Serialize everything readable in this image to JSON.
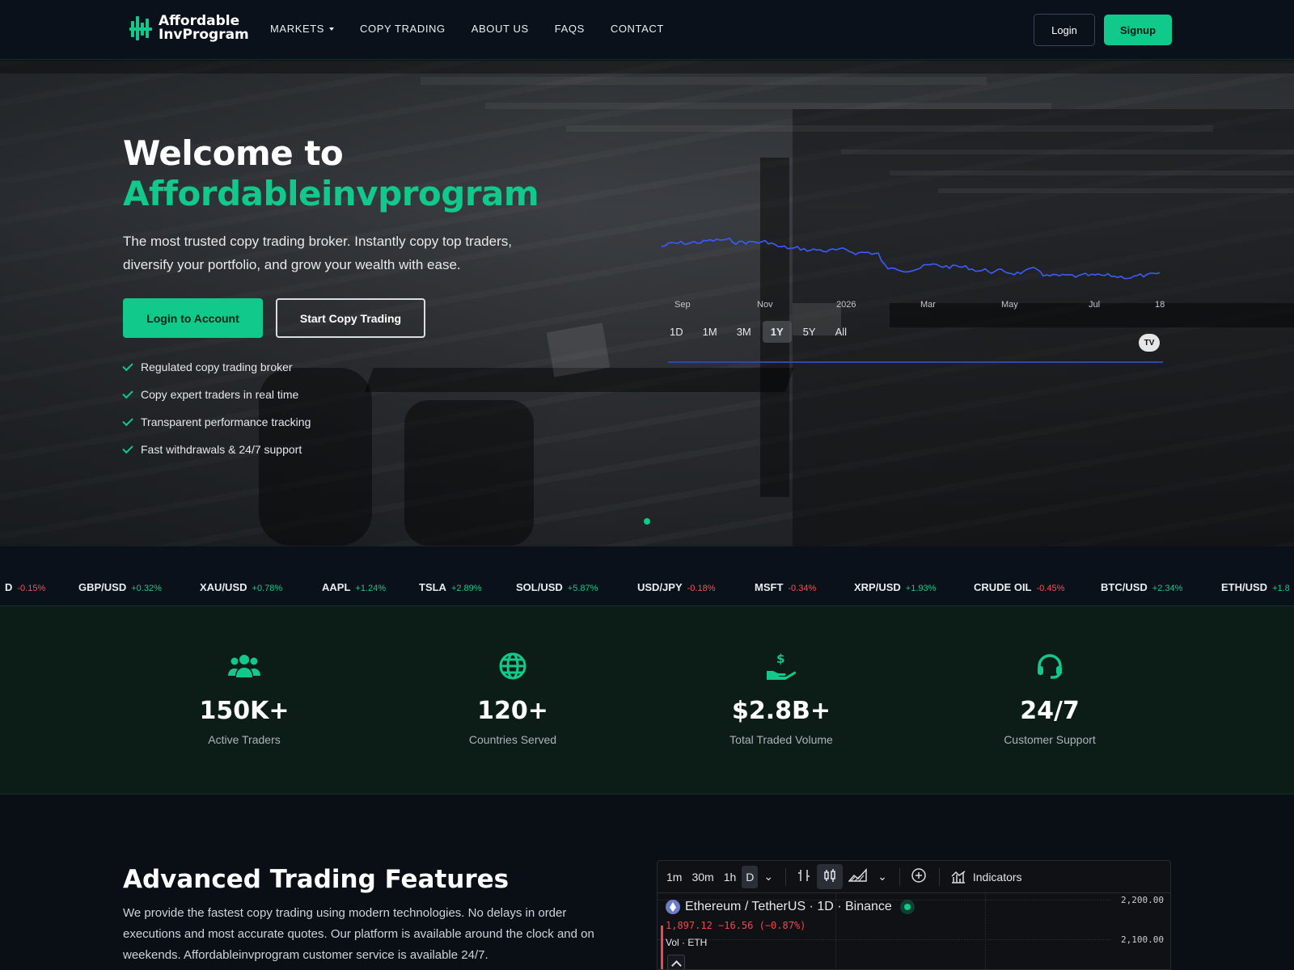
{
  "nav": {
    "logo_line1": "Affordable",
    "logo_line2": "InvProgram",
    "items": [
      "MARKETS",
      "COPY TRADING",
      "ABOUT US",
      "FAQS",
      "CONTACT"
    ],
    "login": "Login",
    "signup": "Signup"
  },
  "hero": {
    "title_line1": "Welcome to",
    "title_line2": "Affordableinvprogram",
    "lead": "The most trusted copy trading broker. Instantly copy top traders, diversify your portfolio, and grow your wealth with ease.",
    "btn_login": "Login to Account",
    "btn_copy": "Start Copy Trading",
    "features": [
      "Regulated copy trading broker",
      "Copy expert traders in real time",
      "Transparent performance tracking",
      "Fast withdrawals & 24/7 support"
    ],
    "mini_chart": {
      "months": [
        "Sep",
        "Nov",
        "2026",
        "Mar",
        "May",
        "Jul",
        "18"
      ],
      "ranges": [
        "1D",
        "1M",
        "3M",
        "1Y",
        "5Y",
        "All"
      ],
      "active_range": "1Y",
      "badge": "TV",
      "line_color": "#3b5cff"
    }
  },
  "ticker": [
    {
      "sym": "D",
      "chg": "-0.15%",
      "dir": "down"
    },
    {
      "sym": "GBP/USD",
      "chg": "+0.32%",
      "dir": "up"
    },
    {
      "sym": "XAU/USD",
      "chg": "+0.78%",
      "dir": "up"
    },
    {
      "sym": "AAPL",
      "chg": "+1.24%",
      "dir": "up"
    },
    {
      "sym": "TSLA",
      "chg": "+2.89%",
      "dir": "up"
    },
    {
      "sym": "SOL/USD",
      "chg": "+5.87%",
      "dir": "up"
    },
    {
      "sym": "USD/JPY",
      "chg": "-0.18%",
      "dir": "down"
    },
    {
      "sym": "MSFT",
      "chg": "-0.34%",
      "dir": "down"
    },
    {
      "sym": "XRP/USD",
      "chg": "+1.93%",
      "dir": "up"
    },
    {
      "sym": "CRUDE OIL",
      "chg": "-0.45%",
      "dir": "down"
    },
    {
      "sym": "BTC/USD",
      "chg": "+2.34%",
      "dir": "up"
    },
    {
      "sym": "ETH/USD",
      "chg": "+1.8",
      "dir": "up"
    }
  ],
  "stats": [
    {
      "icon": "users-icon",
      "num": "150K+",
      "label": "Active Traders"
    },
    {
      "icon": "globe-icon",
      "num": "120+",
      "label": "Countries Served"
    },
    {
      "icon": "money-hand-icon",
      "num": "$2.8B+",
      "label": "Total Traded Volume"
    },
    {
      "icon": "headset-icon",
      "num": "24/7",
      "label": "Customer Support"
    }
  ],
  "advanced": {
    "title": "Advanced Trading Features",
    "text": "We provide the fastest copy trading using modern technologies. No delays in order executions and most accurate quotes. Our platform is available around the clock and on weekends. Affordableinvprogram customer service is available 24/7."
  },
  "tv_widget": {
    "intervals": [
      "1m",
      "30m",
      "1h",
      "D"
    ],
    "indicators": "Indicators",
    "symbol": "Ethereum / TetherUS · 1D · Binance",
    "price": "1,897.12 −16.56 (−0.87%)",
    "vol": "Vol · ETH",
    "axis": [
      "2,200.00",
      "2,100.00"
    ]
  },
  "colors": {
    "accent": "#10c98a",
    "down": "#ff4d4f",
    "bg": "#0a0f16"
  }
}
